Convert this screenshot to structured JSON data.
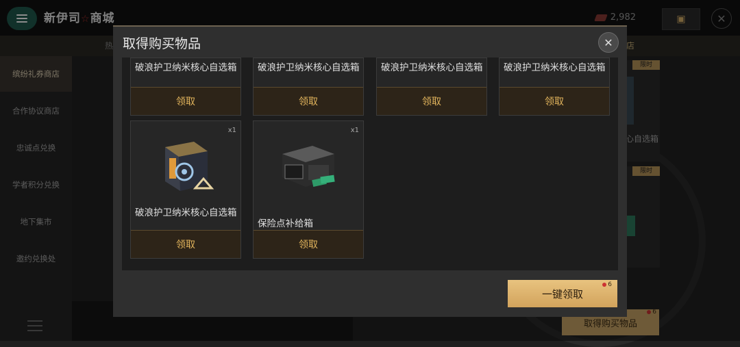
{
  "app": {
    "title_part1": "新伊司",
    "title_star": "☆",
    "title_part2": "商城",
    "currency_amount": "2,982"
  },
  "tabs": {
    "left_partial": "热",
    "right_partial": "店"
  },
  "sidebar": {
    "items": [
      {
        "label": "缤纷礼券商店",
        "active": true
      },
      {
        "label": "合作协议商店",
        "active": false
      },
      {
        "label": "忠诚点兑换",
        "active": false
      },
      {
        "label": "学者积分兑换",
        "active": false
      },
      {
        "label": "地下集市",
        "active": false
      },
      {
        "label": "邀约兑换处",
        "active": false
      }
    ]
  },
  "background_cards": [
    {
      "limit_label": "限时",
      "label": "心自选箱"
    },
    {
      "limit_label": "限时",
      "label": ""
    }
  ],
  "background_button": {
    "label": "取得购买物品",
    "badge": "6"
  },
  "modal": {
    "title": "取得购买物品",
    "close_icon": "close-icon",
    "items": [
      {
        "name": "破浪护卫纳米核心自选箱",
        "claim_label": "领取",
        "qty": ""
      },
      {
        "name": "破浪护卫纳米核心自选箱",
        "claim_label": "领取",
        "qty": ""
      },
      {
        "name": "破浪护卫纳米核心自选箱",
        "claim_label": "领取",
        "qty": ""
      },
      {
        "name": "破浪护卫纳米核心自选箱",
        "claim_label": "领取",
        "qty": ""
      },
      {
        "name": "破浪护卫纳米核心自选箱",
        "claim_label": "领取",
        "qty": "x1",
        "icon": "nano-core-box-icon"
      },
      {
        "name": "保险点补给箱",
        "claim_label": "领取",
        "qty": "x1",
        "icon": "insurance-supply-crate-icon"
      }
    ],
    "claim_all": {
      "label": "一键领取",
      "badge": "6"
    }
  },
  "colors": {
    "accent_gold": "#e2b45c",
    "button_gold": "#d2a35c",
    "menu_green": "#1f5a4d",
    "badge_red": "#cc3333"
  }
}
